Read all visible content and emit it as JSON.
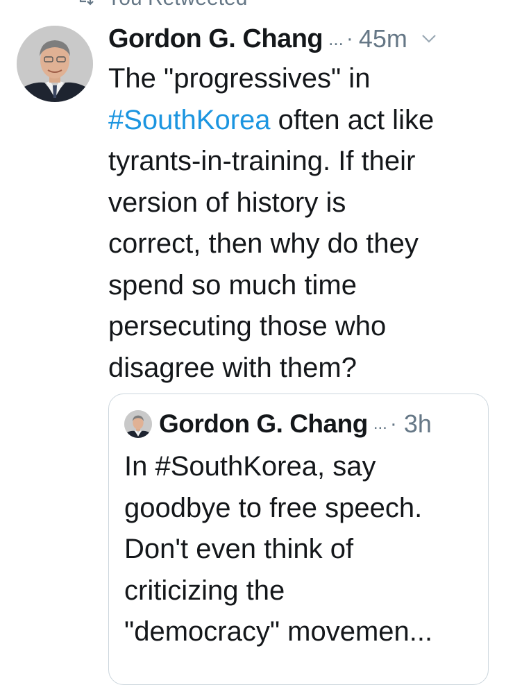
{
  "retweet": {
    "label": "You Retweeted",
    "icon": "retweet-icon"
  },
  "tweet": {
    "author_name": "Gordon G. Chang",
    "author_truncation": "...",
    "separator": "·",
    "timestamp": "45m",
    "menu_icon": "chevron-down-icon",
    "text_lines": [
      {
        "plain": "The \"progressives\" in"
      },
      {
        "hashtag": "#SouthKorea",
        "rest": " often act like"
      },
      {
        "plain": "tyrants-in-training. If their"
      },
      {
        "plain": "version of history is"
      },
      {
        "plain": "correct, then why do they"
      },
      {
        "plain": "spend so much time"
      },
      {
        "plain": "persecuting those who"
      },
      {
        "plain": "disagree with them?"
      }
    ]
  },
  "quoted_tweet": {
    "author_name": "Gordon G. Chang",
    "author_truncation": "...",
    "separator": "·",
    "timestamp": "3h",
    "text_lines": [
      "In #SouthKorea, say",
      "goodbye to free speech.",
      "Don't even think of",
      "criticizing the",
      "\"democracy\" movemen..."
    ]
  },
  "colors": {
    "hashtag": "#1b95e0",
    "secondary_text": "#657786",
    "border": "#ccd6dd",
    "primary_text": "#14171a"
  }
}
